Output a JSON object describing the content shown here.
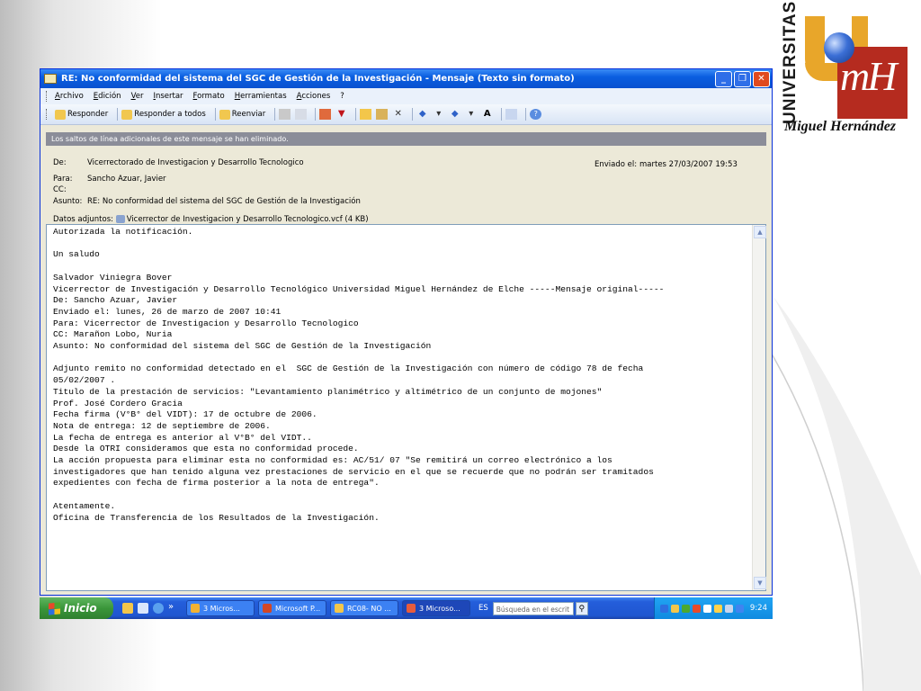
{
  "logo": {
    "vertical_text": "UNIVERSITAS",
    "mark_text": "mH",
    "name": "Miguel Hernández",
    "colors": {
      "gold": "#e8a62a",
      "red": "#b52b1f",
      "blue": "#3b6fd6"
    }
  },
  "window": {
    "title": "RE: No conformidad del sistema del SGC de Gestión de la Investigación - Mensaje (Texto sin formato)",
    "buttons": {
      "minimize": "_",
      "maximize": "❐",
      "close": "✕"
    }
  },
  "menu": [
    "Archivo",
    "Edición",
    "Ver",
    "Insertar",
    "Formato",
    "Herramientas",
    "Acciones",
    "?"
  ],
  "toolbar": {
    "reply": "Responder",
    "reply_all": "Responder a todos",
    "forward": "Reenviar",
    "icons": [
      "print-icon",
      "copy-icon",
      "flag-icon",
      "delete-icon",
      "arrow-icons",
      "font-icon",
      "help-icon"
    ]
  },
  "infobar": "Los saltos de línea adicionales de este mensaje se han eliminado.",
  "headers": {
    "from_label": "De:",
    "from": "Vicerrectorado de Investigacion y Desarrollo Tecnologico",
    "sent_label": "Enviado el:",
    "sent": "martes 27/03/2007 19:53",
    "to_label": "Para:",
    "to": "Sancho Azuar, Javier",
    "cc_label": "CC:",
    "cc": "",
    "subject_label": "Asunto:",
    "subject": "RE: No conformidad del sistema del SGC de Gestión de la Investigación",
    "attachments_label": "Datos adjuntos:",
    "attachment": "Vicerrector de Investigacion y Desarrollo Tecnologico.vcf (4 KB)"
  },
  "body_lines": [
    "Autorizada la notificación.",
    "",
    "Un saludo",
    "",
    "Salvador Viniegra Bover",
    "Vicerrector de Investigación y Desarrollo Tecnológico Universidad Miguel Hernández de Elche -----Mensaje original-----",
    "De: Sancho Azuar, Javier",
    "Enviado el: lunes, 26 de marzo de 2007 10:41",
    "Para: Vicerrector de Investigacion y Desarrollo Tecnologico",
    "CC: Marañon Lobo, Nuria",
    "Asunto: No conformidad del sistema del SGC de Gestión de la Investigación",
    "",
    "Adjunto remito no conformidad detectado en el  SGC de Gestión de la Investigación con número de código 78 de fecha",
    "05/02/2007 .",
    "Titulo de la prestación de servicios: \"Levantamiento planimétrico y altimétrico de un conjunto de mojones\"",
    "Prof. José Cordero Gracia",
    "Fecha firma (V°B° del VIDT): 17 de octubre de 2006.",
    "Nota de entrega: 12 de septiembre de 2006.",
    "La fecha de entrega es anterior al V°B° del VIDT..",
    "Desde la OTRI consideramos que esta no conformidad procede.",
    "La acción propuesta para eliminar esta no conformidad es: AC/51/ 07 \"Se remitirá un correo electrónico a los",
    "investigadores que han tenido alguna vez prestaciones de servicio en el que se recuerde que no podrán ser tramitados",
    "expedientes con fecha de firma posterior a la nota de entrega\".",
    "",
    "Atentamente.",
    "Oficina de Transferencia de los Resultados de la Investigación."
  ],
  "taskbar": {
    "start": "Inicio",
    "chevron": "»",
    "tasks": [
      "3 Micros...",
      "Microsoft P...",
      "RC08- NO ...",
      "3 Microso..."
    ],
    "lang": "ES",
    "search_placeholder": "Búsqueda en el escrit",
    "clock": "9:24"
  }
}
